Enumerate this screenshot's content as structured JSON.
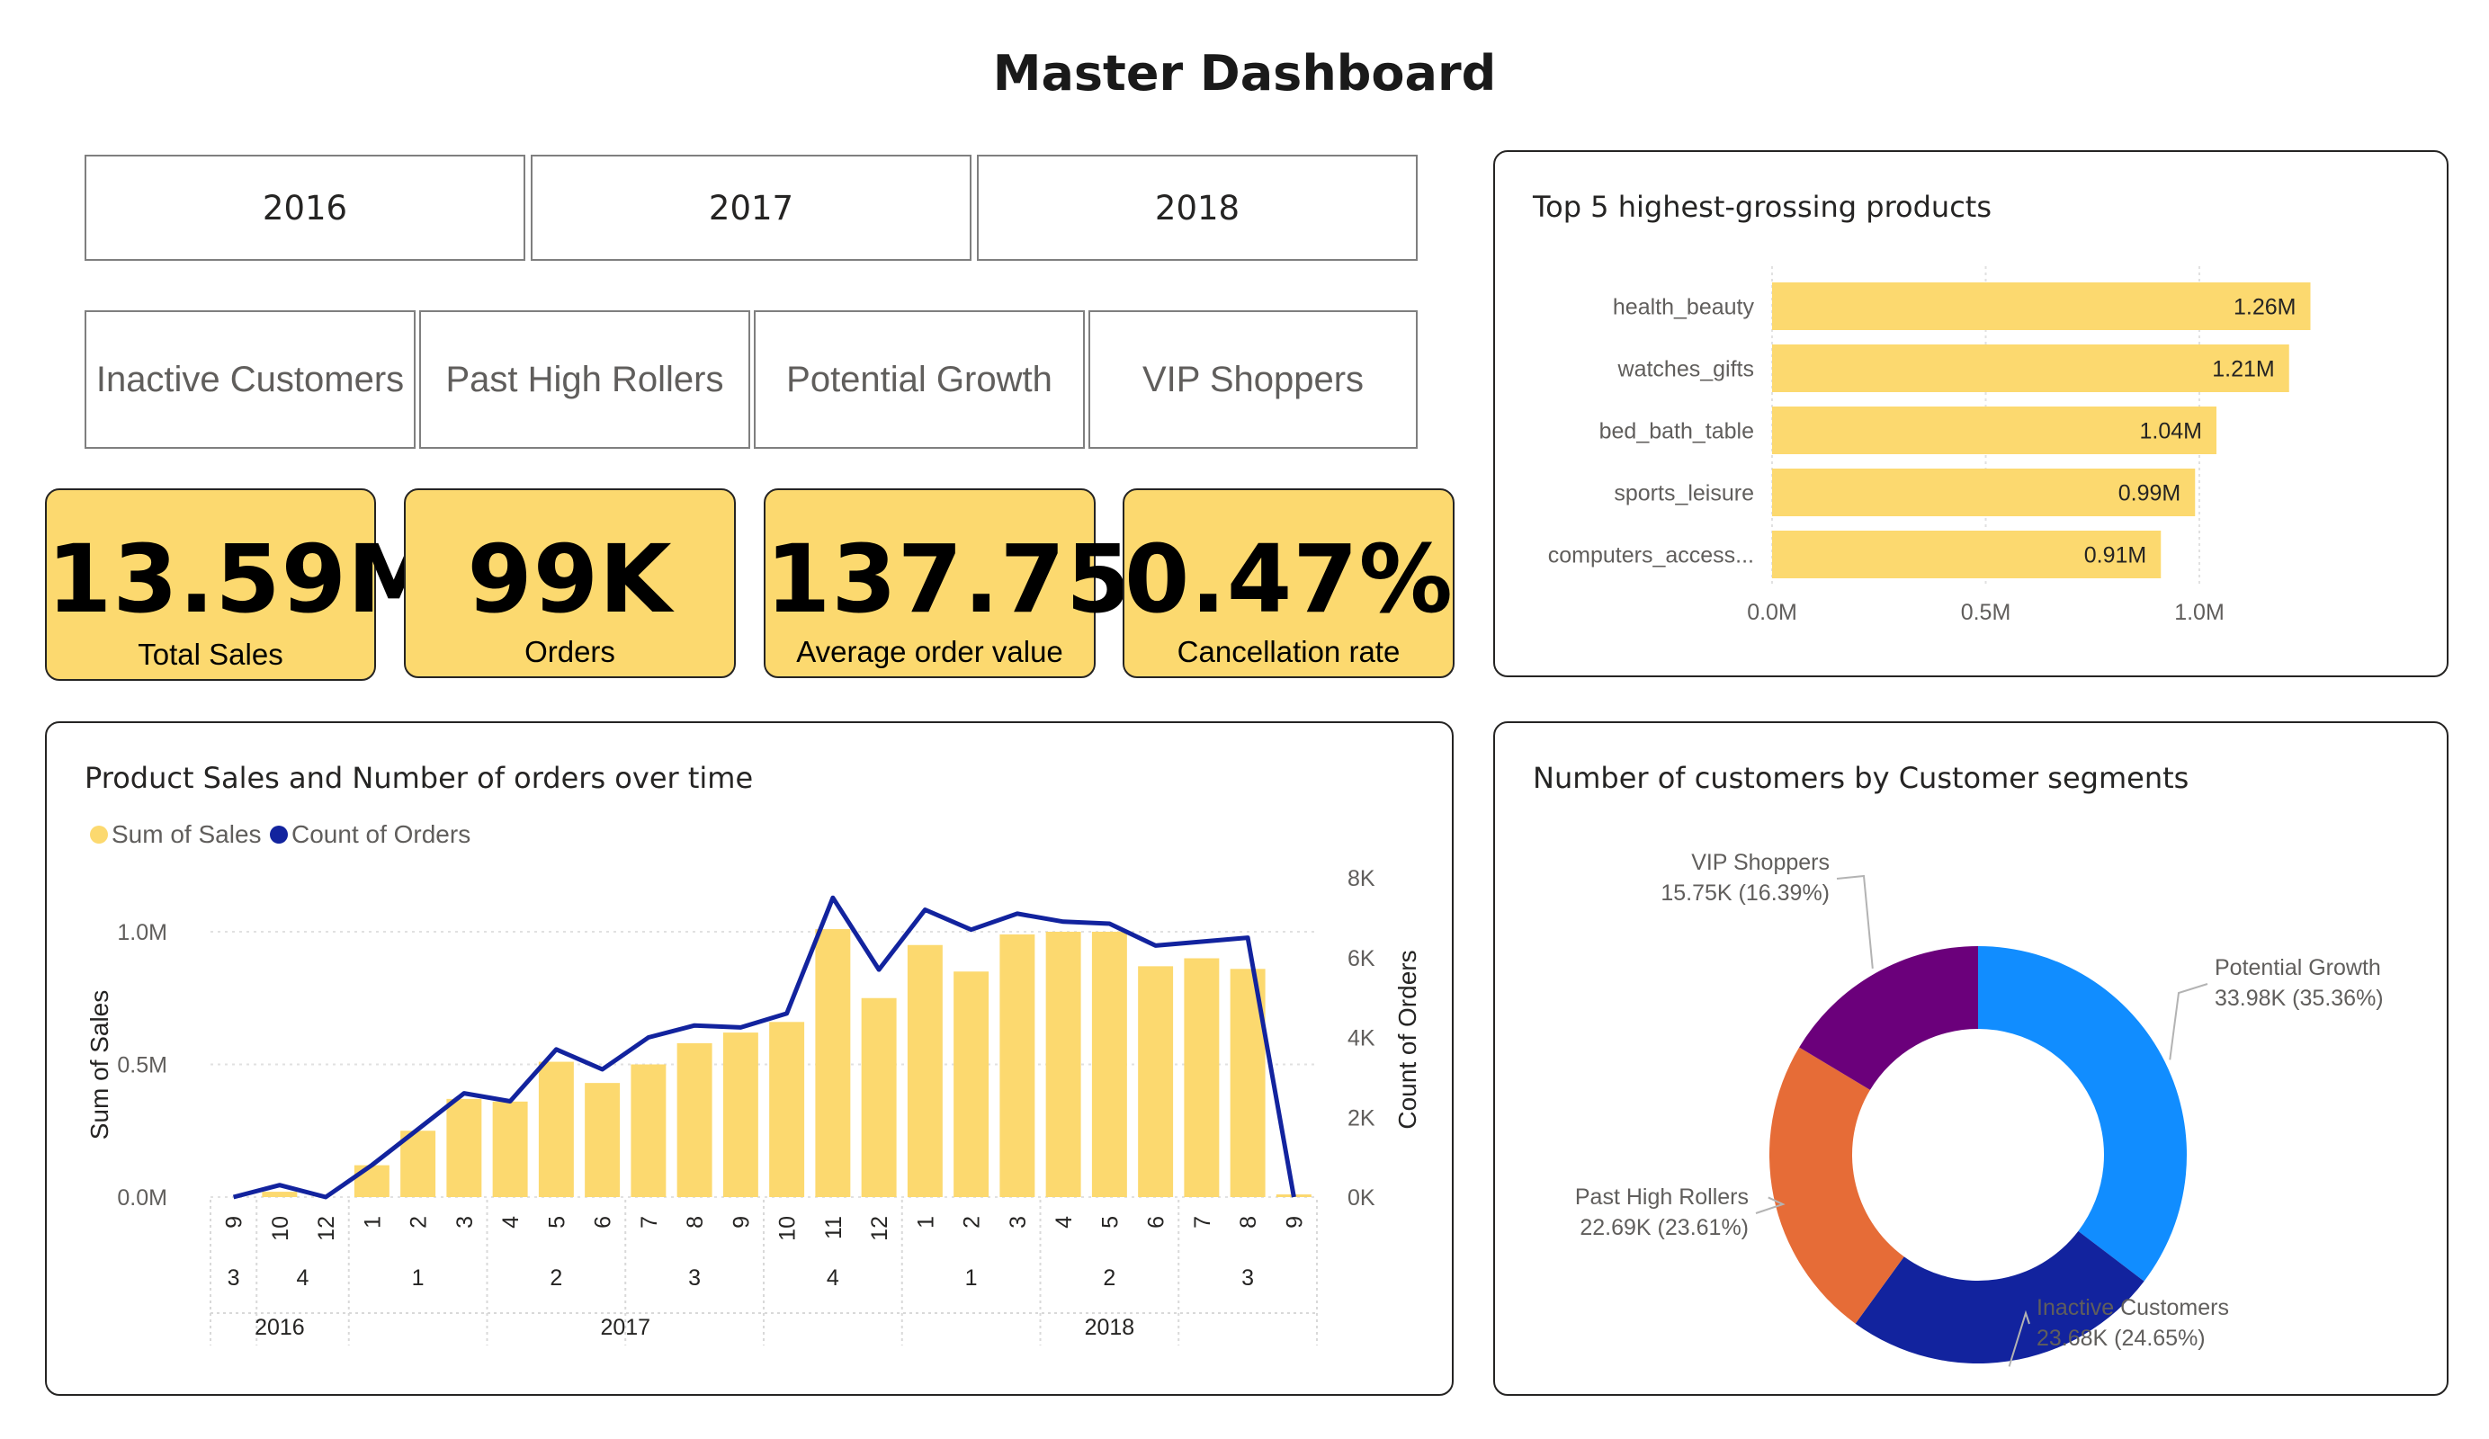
{
  "header": {
    "title": "Master Dashboard"
  },
  "year_buttons": [
    "2016",
    "2017",
    "2018"
  ],
  "segment_buttons": [
    "Inactive Customers",
    "Past High Rollers",
    "Potential Growth",
    "VIP Shoppers"
  ],
  "kpis": [
    {
      "value": "13.59M",
      "label": "Total Sales"
    },
    {
      "value": "99K",
      "label": "Orders"
    },
    {
      "value": "137.75",
      "label": "Average order value"
    },
    {
      "value": "0.47%",
      "label": "Cancellation rate"
    }
  ],
  "colors": {
    "accent_yellow": "#fcd96f",
    "line_blue": "#12239e",
    "border": "#252423"
  },
  "chart_data": [
    {
      "type": "bar",
      "orientation": "horizontal",
      "title": "Top 5 highest-grossing products",
      "categories": [
        "health_beauty",
        "watches_gifts",
        "bed_bath_table",
        "sports_leisure",
        "computers_access..."
      ],
      "values": [
        1.26,
        1.21,
        1.04,
        0.99,
        0.91
      ],
      "value_labels": [
        "1.26M",
        "1.21M",
        "1.04M",
        "0.99M",
        "0.91M"
      ],
      "xlim": [
        0,
        1.35
      ],
      "x_ticks": [
        0,
        0.5,
        1.0
      ],
      "x_tick_labels": [
        "0.0M",
        "0.5M",
        "1.0M"
      ],
      "grid": true
    },
    {
      "type": "bar",
      "combo": "bar+line",
      "title": "Product Sales and Number of orders over time",
      "ylabel": "Sum of Sales",
      "y2label": "Count of Orders",
      "legend": [
        "Sum of Sales",
        "Count of Orders"
      ],
      "legend_position": "top-left",
      "categories": [
        "9",
        "10",
        "12",
        "1",
        "2",
        "3",
        "4",
        "5",
        "6",
        "7",
        "8",
        "9",
        "10",
        "11",
        "12",
        "1",
        "2",
        "3",
        "4",
        "5",
        "6",
        "7",
        "8",
        "9"
      ],
      "quarters": [
        {
          "label": "3",
          "count": 1
        },
        {
          "label": "4",
          "count": 2
        },
        {
          "label": "1",
          "count": 3
        },
        {
          "label": "2",
          "count": 3
        },
        {
          "label": "3",
          "count": 3
        },
        {
          "label": "4",
          "count": 3
        },
        {
          "label": "1",
          "count": 3
        },
        {
          "label": "2",
          "count": 3
        },
        {
          "label": "3",
          "count": 3
        }
      ],
      "years": [
        {
          "label": "2016",
          "count": 3
        },
        {
          "label": "2017",
          "count": 12
        },
        {
          "label": "2018",
          "count": 9
        }
      ],
      "series": [
        {
          "name": "Sum of Sales",
          "values": [
            0,
            0.02,
            0,
            0.12,
            0.25,
            0.37,
            0.36,
            0.51,
            0.43,
            0.5,
            0.58,
            0.62,
            0.66,
            1.01,
            0.75,
            0.95,
            0.85,
            0.99,
            1.0,
            1.0,
            0.87,
            0.9,
            0.86,
            0.01
          ]
        },
        {
          "name": "Count of Orders",
          "values": [
            0,
            300,
            0,
            800,
            1700,
            2600,
            2400,
            3700,
            3200,
            4000,
            4300,
            4250,
            4600,
            7500,
            5700,
            7200,
            6700,
            7100,
            6900,
            6850,
            6300,
            6400,
            6500,
            0
          ]
        }
      ],
      "ylim": [
        0,
        1.1
      ],
      "y_ticks": [
        0,
        0.5,
        1.0
      ],
      "y_tick_labels": [
        "0.0M",
        "0.5M",
        "1.0M"
      ],
      "y2lim": [
        0,
        8000
      ],
      "y2_ticks": [
        0,
        2000,
        4000,
        6000,
        8000
      ],
      "y2_tick_labels": [
        "0K",
        "2K",
        "4K",
        "6K",
        "8K"
      ],
      "grid": true
    },
    {
      "type": "pie",
      "donut": true,
      "title": "Number of customers by Customer segments",
      "slices": [
        {
          "name": "Potential Growth",
          "label": "33.98K (35.36%)",
          "value": 33.98,
          "percent": 35.36,
          "color": "#118dff"
        },
        {
          "name": "Inactive Customers",
          "label": "23.68K (24.65%)",
          "value": 23.68,
          "percent": 24.65,
          "color": "#12239e"
        },
        {
          "name": "Past High Rollers",
          "label": "22.69K (23.61%)",
          "value": 22.69,
          "percent": 23.61,
          "color": "#e66c37"
        },
        {
          "name": "VIP Shoppers",
          "label": "15.75K (16.39%)",
          "value": 15.75,
          "percent": 16.39,
          "color": "#6b007b"
        }
      ]
    }
  ]
}
